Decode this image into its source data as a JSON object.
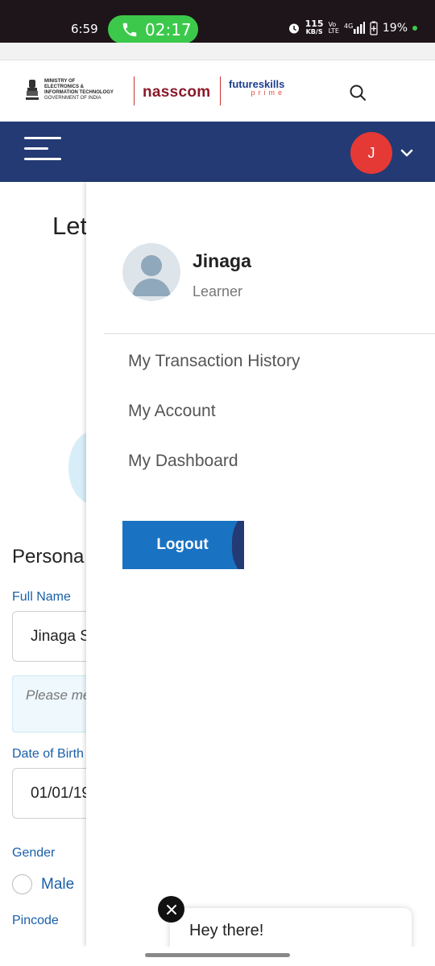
{
  "status_bar": {
    "time": "6:59",
    "call_timer": "02:17",
    "net_speed": "115",
    "net_speed_unit": "KB/S",
    "battery": "19%"
  },
  "header": {
    "ministry_lines": [
      "MINISTRY OF",
      "ELECTRONICS &",
      "INFORMATION TECHNOLOGY",
      "GOVERNMENT OF INDIA"
    ],
    "nasscom": "nasscom",
    "futureskills": "futureskills",
    "prime": "prime"
  },
  "navbar": {
    "avatar_initial": "J"
  },
  "background_page": {
    "heading": "Let",
    "section_title": "Persona",
    "full_name_label": "Full Name",
    "full_name_value": "Jinaga S",
    "note_text": "Please me this name",
    "dob_label": "Date of Birth",
    "dob_value": "01/01/19",
    "gender_label": "Gender",
    "gender_option": "Male",
    "pincode_label": "Pincode"
  },
  "drawer": {
    "user_name": "Jinaga",
    "user_role": "Learner",
    "menu": [
      {
        "label": "My Transaction History"
      },
      {
        "label": "My Account"
      },
      {
        "label": "My Dashboard"
      }
    ],
    "logout_label": "Logout"
  },
  "chat": {
    "message": "Hey there!"
  },
  "colors": {
    "navbar": "#233a74",
    "avatar": "#e53935",
    "logout_button": "#1a72c2",
    "call_pill": "#3cc94b"
  }
}
